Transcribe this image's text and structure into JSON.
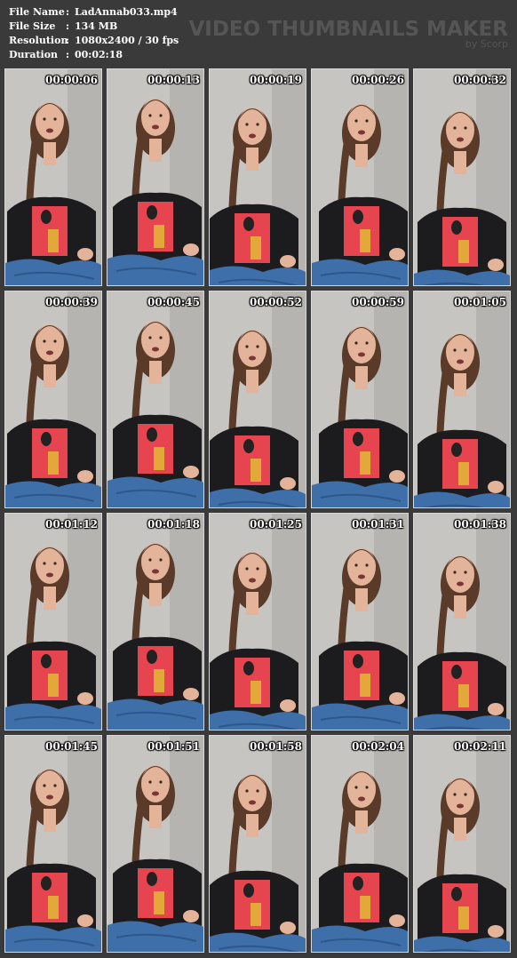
{
  "info": {
    "rows": [
      {
        "key": "File Name",
        "value": "LadAnnab033.mp4"
      },
      {
        "key": "File Size",
        "value": "134 MB"
      },
      {
        "key": "Resolution",
        "value": "1080x2400 / 30 fps"
      },
      {
        "key": "Duration",
        "value": "00:02:18"
      }
    ],
    "separator": ":"
  },
  "brand": {
    "title": "VIDEO THUMBNAILS MAKER",
    "byline": "by Scorp"
  },
  "thumbnails": [
    {
      "time": "00:00:06"
    },
    {
      "time": "00:00:13"
    },
    {
      "time": "00:00:19"
    },
    {
      "time": "00:00:26"
    },
    {
      "time": "00:00:32"
    },
    {
      "time": "00:00:39"
    },
    {
      "time": "00:00:45"
    },
    {
      "time": "00:00:52"
    },
    {
      "time": "00:00:59"
    },
    {
      "time": "00:01:05"
    },
    {
      "time": "00:01:12"
    },
    {
      "time": "00:01:18"
    },
    {
      "time": "00:01:25"
    },
    {
      "time": "00:01:31"
    },
    {
      "time": "00:01:38"
    },
    {
      "time": "00:01:45"
    },
    {
      "time": "00:01:51"
    },
    {
      "time": "00:01:58"
    },
    {
      "time": "00:02:04"
    },
    {
      "time": "00:02:11"
    }
  ],
  "colors": {
    "background": "#3a3a3a",
    "info_text": "#ffffff",
    "brand_text": "#555555",
    "shirt": "#1c1c1e",
    "print": "#e64550",
    "jeans": "#3f6fa8",
    "skin": "#e3b49a",
    "hair": "#5a3a28"
  }
}
